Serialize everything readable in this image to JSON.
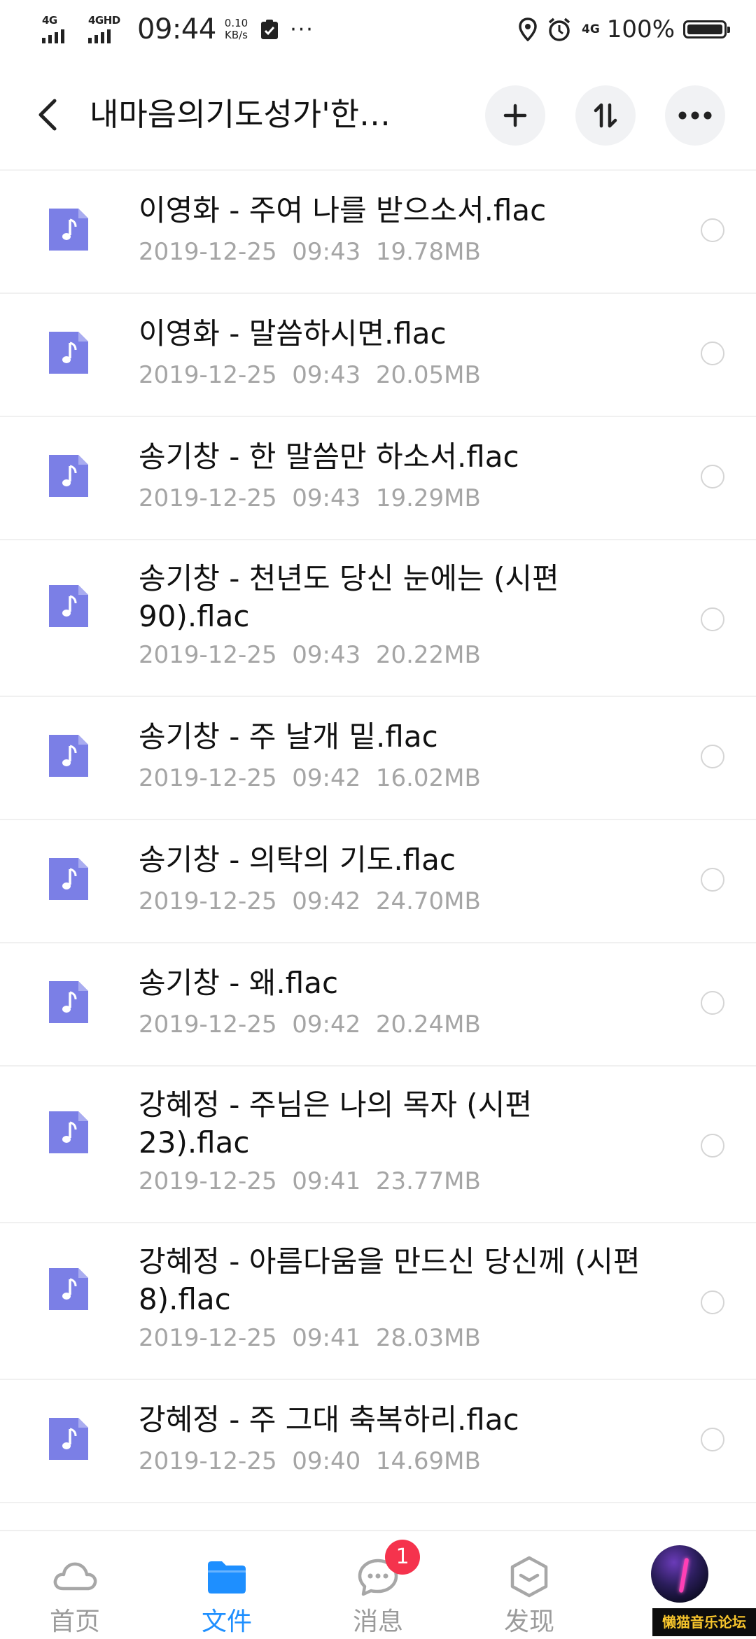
{
  "status_bar": {
    "signal1": "4G",
    "signal2": "4GHD",
    "time": "09:44",
    "net_speed_value": "0.10",
    "net_speed_unit": "KB/s",
    "more": "···",
    "network": "4G",
    "battery": "100%"
  },
  "header": {
    "title": "내마음의기도성가'한…"
  },
  "files": [
    {
      "name": "이영화 - 주여 나를 받으소서.flac",
      "date": "2019-12-25",
      "time": "09:43",
      "size": "19.78MB"
    },
    {
      "name": "이영화 - 말씀하시면.flac",
      "date": "2019-12-25",
      "time": "09:43",
      "size": "20.05MB"
    },
    {
      "name": "송기창 - 한 말씀만 하소서.flac",
      "date": "2019-12-25",
      "time": "09:43",
      "size": "19.29MB"
    },
    {
      "name": "송기창 - 천년도 당신 눈에는 (시편 90).flac",
      "date": "2019-12-25",
      "time": "09:43",
      "size": "20.22MB"
    },
    {
      "name": "송기창 - 주 날개 밑.flac",
      "date": "2019-12-25",
      "time": "09:42",
      "size": "16.02MB"
    },
    {
      "name": "송기창 - 의탁의 기도.flac",
      "date": "2019-12-25",
      "time": "09:42",
      "size": "24.70MB"
    },
    {
      "name": "송기창 - 왜.flac",
      "date": "2019-12-25",
      "time": "09:42",
      "size": "20.24MB"
    },
    {
      "name": "강혜정 - 주님은 나의 목자 (시편 23).flac",
      "date": "2019-12-25",
      "time": "09:41",
      "size": "23.77MB"
    },
    {
      "name": "강혜정 - 아름다움을 만드신 당신께 (시편 8).flac",
      "date": "2019-12-25",
      "time": "09:41",
      "size": "28.03MB"
    },
    {
      "name": "강혜정 - 주 그대 축복하리.flac",
      "date": "2019-12-25",
      "time": "09:40",
      "size": "14.69MB"
    }
  ],
  "nav": {
    "home": "首页",
    "files": "文件",
    "messages": "消息",
    "messages_badge": "1",
    "discover": "发现"
  },
  "watermark": "懒猫音乐论坛",
  "colors": {
    "accent": "#1e8fff",
    "file_icon": "#7b7fe6",
    "badge": "#f5334d"
  }
}
